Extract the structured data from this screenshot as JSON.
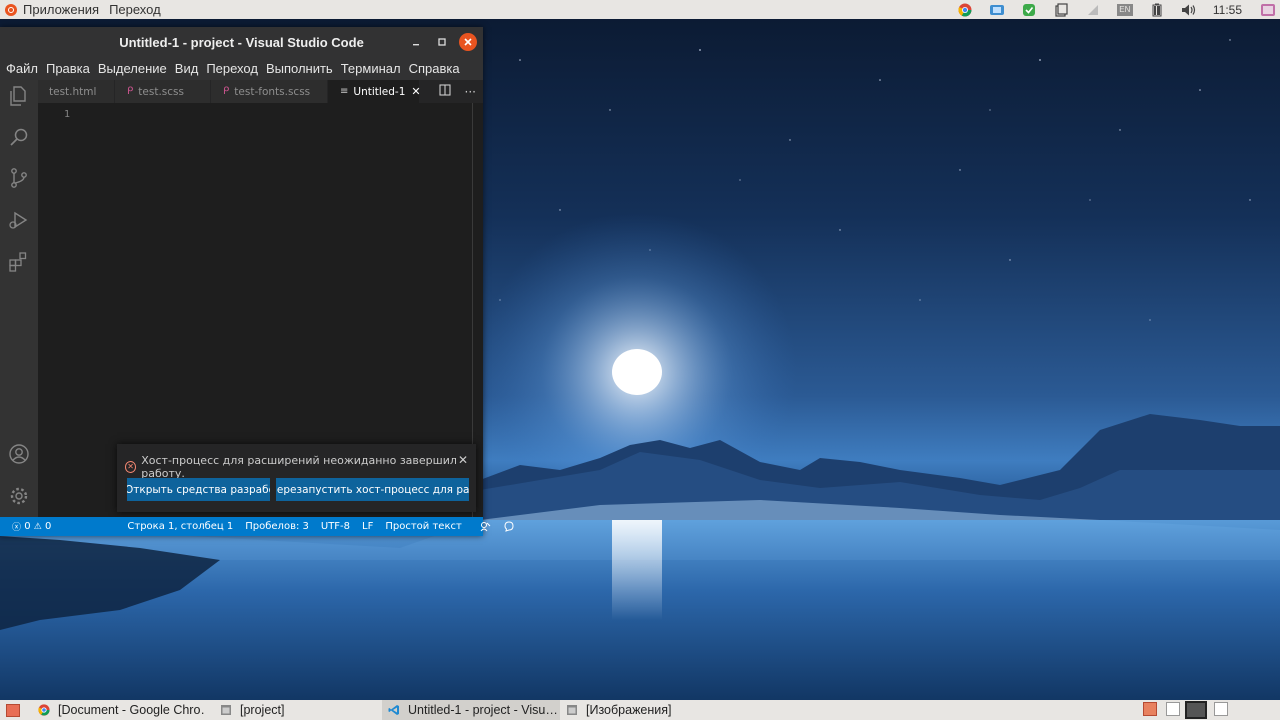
{
  "top_panel": {
    "apps_menu": "Приложения",
    "places_menu": "Переход",
    "tray_icons": [
      "chrome-icon",
      "screenshot-icon",
      "update-icon",
      "clipboard-icon",
      "network-icon",
      "keyboard-layout-icon",
      "battery-icon",
      "volume-icon"
    ],
    "keyboard_layout": "EN",
    "clock": "11:55"
  },
  "window": {
    "title": "Untitled-1 - project - Visual Studio Code",
    "menu": [
      "Файл",
      "Правка",
      "Выделение",
      "Вид",
      "Переход",
      "Выполнить",
      "Терминал",
      "Справка"
    ],
    "tabs": [
      {
        "label": "test.html",
        "icon": ""
      },
      {
        "label": "test.scss",
        "icon": "scss-icon"
      },
      {
        "label": "test-fonts.scss",
        "icon": "scss-icon"
      },
      {
        "label": "Untitled-1",
        "icon": "text-file-icon",
        "active": true
      }
    ],
    "line_number": "1",
    "notification": {
      "message": "Хост-процесс для расширений неожиданно завершил работу.",
      "button1": "Открыть средства разработчика",
      "button2": "Перезапустить хост-процесс для расширений"
    },
    "status": {
      "errors": "0",
      "warnings": "0",
      "position": "Строка 1, столбец 1",
      "spaces": "Пробелов: 3",
      "encoding": "UTF-8",
      "eol": "LF",
      "language": "Простой текст"
    }
  },
  "taskbar": {
    "items": [
      {
        "label": "[Document - Google Chro…",
        "icon": "chrome-icon"
      },
      {
        "label": "[project]",
        "icon": "window-icon"
      },
      {
        "label": "Untitled-1 - project - Visu…",
        "icon": "vscode-icon",
        "active": true
      },
      {
        "label": "[Изображения]",
        "icon": "window-icon"
      }
    ]
  },
  "colors": {
    "accent_ubuntu": "#e95420",
    "statusbar": "#007acc",
    "button": "#0e639c"
  }
}
